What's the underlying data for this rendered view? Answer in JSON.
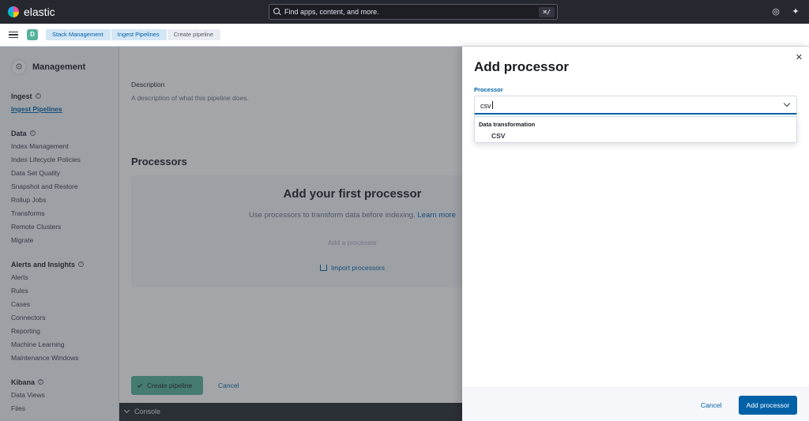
{
  "header": {
    "logo_text": "elastic",
    "search_placeholder": "Find apps, content, and more.",
    "search_shortcut": "⌘/",
    "help_icon": "help-ring-icon",
    "news_icon": "cheer-icon"
  },
  "subheader": {
    "avatar_letter": "D",
    "breadcrumbs": [
      "Stack Management",
      "Ingest Pipelines",
      "Create pipeline"
    ]
  },
  "sidebar": {
    "title": "Management",
    "groups": [
      {
        "title": "Ingest",
        "items": [
          "Ingest Pipelines"
        ]
      },
      {
        "title": "Data",
        "items": [
          "Index Management",
          "Index Lifecycle Policies",
          "Data Set Quality",
          "Snapshot and Restore",
          "Rollup Jobs",
          "Transforms",
          "Remote Clusters",
          "Migrate"
        ]
      },
      {
        "title": "Alerts and Insights",
        "items": [
          "Alerts",
          "Rules",
          "Cases",
          "Connectors",
          "Reporting",
          "Machine Learning",
          "Maintenance Windows"
        ]
      },
      {
        "title": "Kibana",
        "items": [
          "Data Views",
          "Files"
        ]
      }
    ]
  },
  "main": {
    "description_label": "Description",
    "description_text": "A description of what this pipeline does.",
    "processors_title": "Processors",
    "empty_title": "Add your first processor",
    "empty_body": "Use processors to transform data before indexing.",
    "learn_more": "Learn more",
    "add_processor": "Add a processor",
    "import_processors": "Import processors",
    "create_pipeline": "Create pipeline",
    "cancel": "Cancel",
    "console": "Console"
  },
  "flyout": {
    "title": "Add processor",
    "field_label": "Processor",
    "field_value": "csv",
    "group_label": "Data transformation",
    "option_label": "CSV",
    "cancel": "Cancel",
    "submit": "Add processor",
    "close_icon": "cross-icon"
  }
}
